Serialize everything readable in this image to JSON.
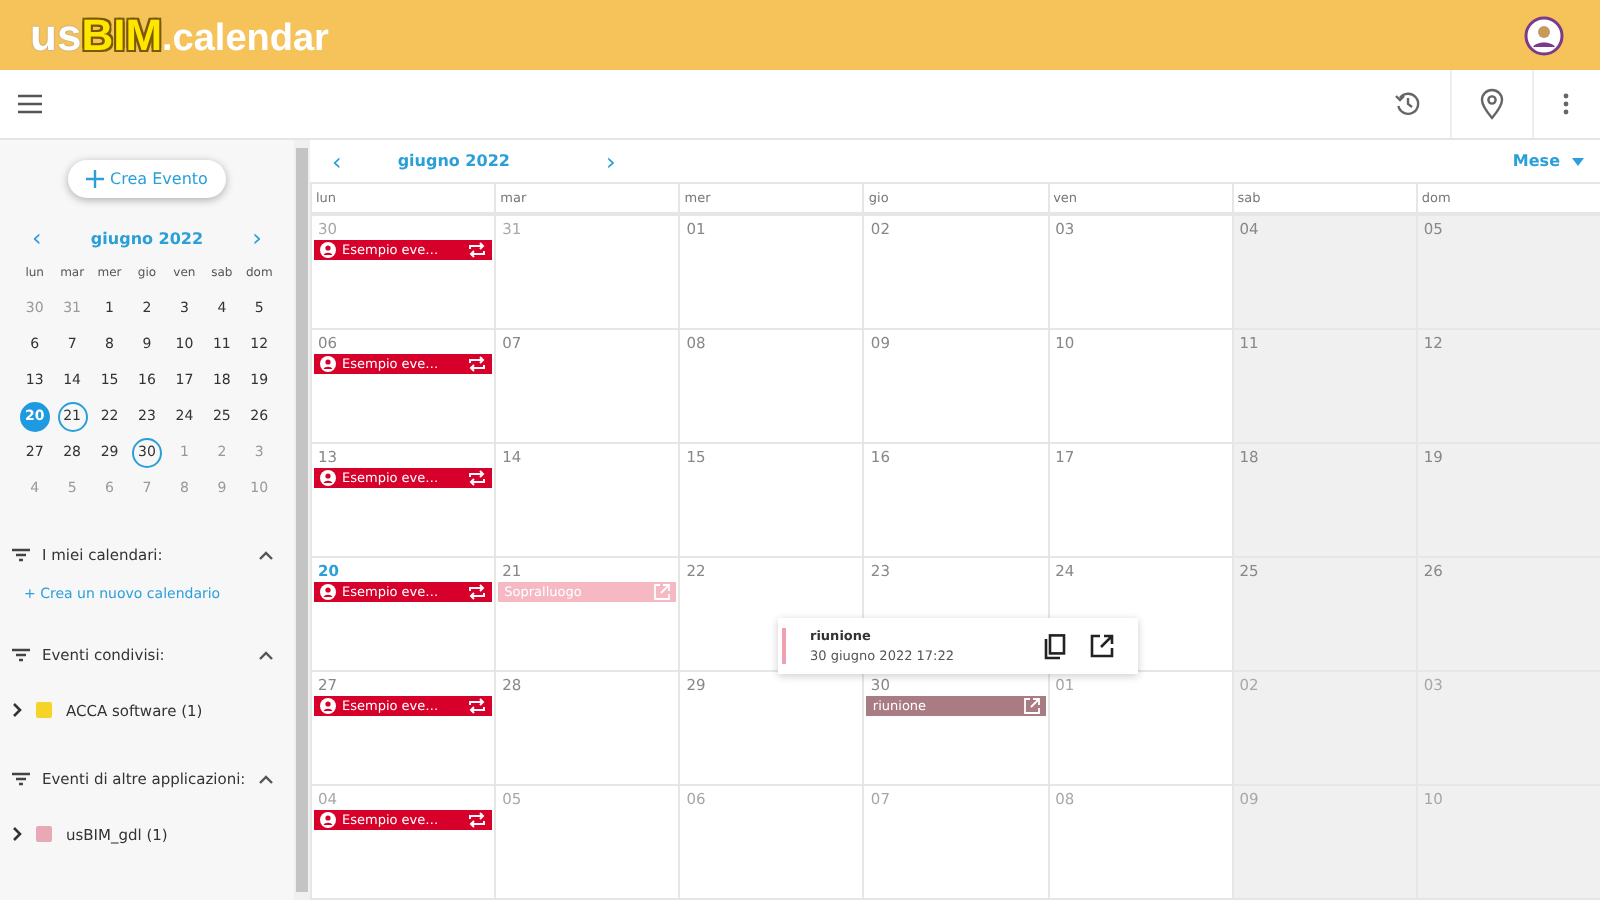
{
  "app": {
    "logo_prefix": "us",
    "logo_brand": "BIM",
    "logo_suffix": ".calendar"
  },
  "sidebar": {
    "create_button": "Crea Evento",
    "mini_calendar": {
      "title": "giugno 2022",
      "prev": "‹",
      "next": "›",
      "weekdays": [
        "lun",
        "mar",
        "mer",
        "gio",
        "ven",
        "sab",
        "dom"
      ],
      "days": [
        {
          "n": "30",
          "muted": true,
          "selected": false,
          "marked": false
        },
        {
          "n": "31",
          "muted": true,
          "selected": false,
          "marked": false
        },
        {
          "n": "1",
          "muted": false,
          "selected": false,
          "marked": false
        },
        {
          "n": "2",
          "muted": false,
          "selected": false,
          "marked": false
        },
        {
          "n": "3",
          "muted": false,
          "selected": false,
          "marked": false
        },
        {
          "n": "4",
          "muted": false,
          "selected": false,
          "marked": false
        },
        {
          "n": "5",
          "muted": false,
          "selected": false,
          "marked": false
        },
        {
          "n": "6",
          "muted": false,
          "selected": false,
          "marked": false
        },
        {
          "n": "7",
          "muted": false,
          "selected": false,
          "marked": false
        },
        {
          "n": "8",
          "muted": false,
          "selected": false,
          "marked": false
        },
        {
          "n": "9",
          "muted": false,
          "selected": false,
          "marked": false
        },
        {
          "n": "10",
          "muted": false,
          "selected": false,
          "marked": false
        },
        {
          "n": "11",
          "muted": false,
          "selected": false,
          "marked": false
        },
        {
          "n": "12",
          "muted": false,
          "selected": false,
          "marked": false
        },
        {
          "n": "13",
          "muted": false,
          "selected": false,
          "marked": false
        },
        {
          "n": "14",
          "muted": false,
          "selected": false,
          "marked": false
        },
        {
          "n": "15",
          "muted": false,
          "selected": false,
          "marked": false
        },
        {
          "n": "16",
          "muted": false,
          "selected": false,
          "marked": false
        },
        {
          "n": "17",
          "muted": false,
          "selected": false,
          "marked": false
        },
        {
          "n": "18",
          "muted": false,
          "selected": false,
          "marked": false
        },
        {
          "n": "19",
          "muted": false,
          "selected": false,
          "marked": false
        },
        {
          "n": "20",
          "muted": false,
          "selected": true,
          "marked": false
        },
        {
          "n": "21",
          "muted": false,
          "selected": false,
          "marked": true
        },
        {
          "n": "22",
          "muted": false,
          "selected": false,
          "marked": false
        },
        {
          "n": "23",
          "muted": false,
          "selected": false,
          "marked": false
        },
        {
          "n": "24",
          "muted": false,
          "selected": false,
          "marked": false
        },
        {
          "n": "25",
          "muted": false,
          "selected": false,
          "marked": false
        },
        {
          "n": "26",
          "muted": false,
          "selected": false,
          "marked": false
        },
        {
          "n": "27",
          "muted": false,
          "selected": false,
          "marked": false
        },
        {
          "n": "28",
          "muted": false,
          "selected": false,
          "marked": false
        },
        {
          "n": "29",
          "muted": false,
          "selected": false,
          "marked": false
        },
        {
          "n": "30",
          "muted": false,
          "selected": false,
          "marked": true
        },
        {
          "n": "1",
          "muted": true,
          "selected": false,
          "marked": false
        },
        {
          "n": "2",
          "muted": true,
          "selected": false,
          "marked": false
        },
        {
          "n": "3",
          "muted": true,
          "selected": false,
          "marked": false
        },
        {
          "n": "4",
          "muted": true,
          "selected": false,
          "marked": false
        },
        {
          "n": "5",
          "muted": true,
          "selected": false,
          "marked": false
        },
        {
          "n": "6",
          "muted": true,
          "selected": false,
          "marked": false
        },
        {
          "n": "7",
          "muted": true,
          "selected": false,
          "marked": false
        },
        {
          "n": "8",
          "muted": true,
          "selected": false,
          "marked": false
        },
        {
          "n": "9",
          "muted": true,
          "selected": false,
          "marked": false
        },
        {
          "n": "10",
          "muted": true,
          "selected": false,
          "marked": false
        }
      ]
    },
    "sections": [
      {
        "title": "I miei calendari:",
        "expanded": true,
        "link": "+ Crea un nuovo calendario"
      },
      {
        "title": "Eventi condivisi:",
        "expanded": true,
        "items": [
          {
            "label": "ACCA software (1)",
            "color": "#f5d327"
          }
        ]
      },
      {
        "title": "Eventi di altre applicazioni:",
        "expanded": true,
        "items": [
          {
            "label": "usBIM_gdl (1)",
            "color": "#e8a8b4"
          }
        ]
      }
    ]
  },
  "calendar": {
    "title": "giugno 2022",
    "prev": "‹",
    "next": "›",
    "view": "Mese",
    "weekdays": [
      "lun",
      "mar",
      "mer",
      "gio",
      "ven",
      "sab",
      "dom"
    ],
    "weeks": [
      {
        "days": [
          {
            "n": "30",
            "muted": true,
            "today": false,
            "events": [
              {
                "kind": "recurring",
                "title": "Esempio eve…",
                "color": "#d6002a"
              }
            ]
          },
          {
            "n": "31",
            "muted": true,
            "today": false
          },
          {
            "n": "01",
            "muted": false,
            "today": false
          },
          {
            "n": "02",
            "muted": false,
            "today": false
          },
          {
            "n": "03",
            "muted": false,
            "today": false
          },
          {
            "n": "04",
            "muted": false,
            "today": false
          },
          {
            "n": "05",
            "muted": false,
            "today": false
          }
        ]
      },
      {
        "days": [
          {
            "n": "06",
            "muted": false,
            "today": false,
            "events": [
              {
                "kind": "recurring",
                "title": "Esempio eve…",
                "color": "#d6002a"
              }
            ]
          },
          {
            "n": "07",
            "muted": false,
            "today": false
          },
          {
            "n": "08",
            "muted": false,
            "today": false
          },
          {
            "n": "09",
            "muted": false,
            "today": false
          },
          {
            "n": "10",
            "muted": false,
            "today": false
          },
          {
            "n": "11",
            "muted": false,
            "today": false
          },
          {
            "n": "12",
            "muted": false,
            "today": false
          }
        ]
      },
      {
        "days": [
          {
            "n": "13",
            "muted": false,
            "today": false,
            "events": [
              {
                "kind": "recurring",
                "title": "Esempio eve…",
                "color": "#d6002a"
              }
            ]
          },
          {
            "n": "14",
            "muted": false,
            "today": false
          },
          {
            "n": "15",
            "muted": false,
            "today": false
          },
          {
            "n": "16",
            "muted": false,
            "today": false
          },
          {
            "n": "17",
            "muted": false,
            "today": false
          },
          {
            "n": "18",
            "muted": false,
            "today": false
          },
          {
            "n": "19",
            "muted": false,
            "today": false
          }
        ]
      },
      {
        "days": [
          {
            "n": "20",
            "muted": false,
            "today": true,
            "events": [
              {
                "kind": "recurring",
                "title": "Esempio eve…",
                "color": "#d6002a"
              }
            ]
          },
          {
            "n": "21",
            "muted": false,
            "today": false,
            "events": [
              {
                "kind": "external",
                "title": "Sopralluogo",
                "color": "#f6b8c2"
              }
            ]
          },
          {
            "n": "22",
            "muted": false,
            "today": false
          },
          {
            "n": "23",
            "muted": false,
            "today": false
          },
          {
            "n": "24",
            "muted": false,
            "today": false
          },
          {
            "n": "25",
            "muted": false,
            "today": false
          },
          {
            "n": "26",
            "muted": false,
            "today": false
          }
        ]
      },
      {
        "days": [
          {
            "n": "27",
            "muted": false,
            "today": false,
            "events": [
              {
                "kind": "recurring",
                "title": "Esempio eve…",
                "color": "#d6002a"
              }
            ]
          },
          {
            "n": "28",
            "muted": false,
            "today": false
          },
          {
            "n": "29",
            "muted": false,
            "today": false
          },
          {
            "n": "30",
            "muted": false,
            "today": false,
            "events": [
              {
                "kind": "external",
                "title": "riunione",
                "color": "#a97c84"
              }
            ]
          },
          {
            "n": "01",
            "muted": true,
            "today": false
          },
          {
            "n": "02",
            "muted": true,
            "today": false
          },
          {
            "n": "03",
            "muted": true,
            "today": false
          }
        ]
      },
      {
        "days": [
          {
            "n": "04",
            "muted": true,
            "today": false,
            "events": [
              {
                "kind": "recurring",
                "title": "Esempio eve…",
                "color": "#d6002a"
              }
            ]
          },
          {
            "n": "05",
            "muted": true,
            "today": false
          },
          {
            "n": "06",
            "muted": true,
            "today": false
          },
          {
            "n": "07",
            "muted": true,
            "today": false
          },
          {
            "n": "08",
            "muted": true,
            "today": false
          },
          {
            "n": "09",
            "muted": true,
            "today": false
          },
          {
            "n": "10",
            "muted": true,
            "today": false
          }
        ]
      }
    ],
    "popup": {
      "title": "riunione",
      "datetime": "30 giugno 2022 17:22"
    }
  }
}
